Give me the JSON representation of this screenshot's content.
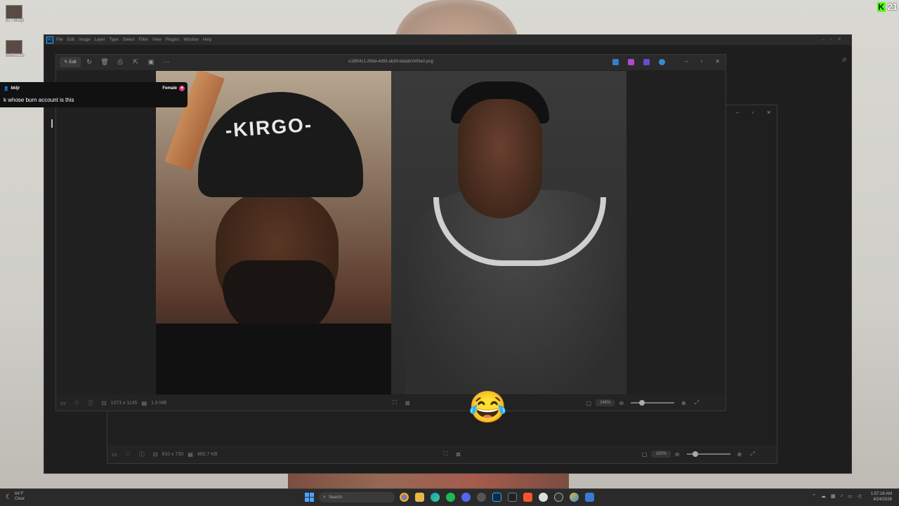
{
  "stream": {
    "kick_count": "21"
  },
  "desktop": {
    "icons": [
      {
        "label": "ds-78loq3"
      },
      {
        "label": "elbwsl21b"
      }
    ]
  },
  "photoshop": {
    "menu": [
      "File",
      "Edit",
      "Image",
      "Layer",
      "Type",
      "Select",
      "Filter",
      "View",
      "Plugins",
      "Window",
      "Help"
    ]
  },
  "viewer": {
    "edit_label": "Edit",
    "filename": "e18f04c1-26bd-4d93-ab39-bddafc04f3e0.png",
    "dimensions": "1373 x 1145",
    "filesize": "1.9 MB",
    "zoom": "146%"
  },
  "viewer2": {
    "dimensions": "810 x 730",
    "filesize": "460.7 KB",
    "zoom": "100%"
  },
  "image": {
    "cap_text": "-KIRGO-"
  },
  "chat": {
    "username": "bkljr",
    "gender": "Female",
    "message": "k whose burn account is this"
  },
  "taskbar": {
    "weather_temp": "64°F",
    "weather_cond": "Clear",
    "search_placeholder": "Search",
    "time": "1:57:16 AM",
    "date": "4/24/2026"
  },
  "emoji": "😂",
  "colors": {
    "kick_green": "#53fc18",
    "ps_blue": "#31a8ff",
    "chat_gender": "#d43a7a"
  }
}
